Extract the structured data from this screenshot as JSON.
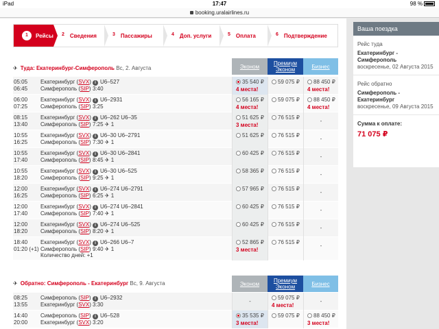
{
  "status": {
    "device": "iPad",
    "time": "17:47",
    "battery": "98 %"
  },
  "url": "booking.uralairlines.ru",
  "steps": [
    {
      "num": "1",
      "label": "Рейсы"
    },
    {
      "num": "2",
      "label": "Сведения"
    },
    {
      "num": "3",
      "label": "Пассажиры"
    },
    {
      "num": "4",
      "label": "Доп. услуги"
    },
    {
      "num": "5",
      "label": "Оплата"
    },
    {
      "num": "6",
      "label": "Подтверждение"
    }
  ],
  "fares": {
    "economy": "Эконом",
    "premium": "Премиум Эконом",
    "business": "Бизнес"
  },
  "outbound": {
    "title": "Туда: Екатеринбург-Симферополь",
    "date": "Вс, 2. Августа",
    "rows": [
      {
        "t1": "05:05",
        "t2": "06:45",
        "c1": "Екатеринбург",
        "k1": "SVX",
        "c2": "Симферополь",
        "k2": "SIP",
        "fl": "U6–527",
        "dur": "3:40",
        "eco": "35 540 ₽",
        "eco_seats": "4 места!",
        "eco_sel": true,
        "prem": "59 075 ₽",
        "prem_seats": "",
        "bus": "88 450 ₽",
        "bus_seats": "4 места!"
      },
      {
        "t1": "06:00",
        "t2": "07:25",
        "c1": "Екатеринбург",
        "k1": "SVX",
        "c2": "Симферополь",
        "k2": "SIP",
        "fl": "U6–2931",
        "dur": "3:25",
        "eco": "56 165 ₽",
        "eco_seats": "4 места!",
        "prem": "59 075 ₽",
        "prem_seats": "",
        "bus": "88 450 ₽",
        "bus_seats": "4 места!"
      },
      {
        "t1": "08:15",
        "t2": "13:40",
        "c1": "Екатеринбург",
        "k1": "SVX",
        "c2": "Симферополь",
        "k2": "SIP",
        "fl": "U6–262  U6–35",
        "dur": "7:25 ✈ 1",
        "eco": "51 625 ₽",
        "eco_seats": "3 места!",
        "prem": "76 515 ₽",
        "prem_seats": "",
        "bus": "-",
        "bus_seats": ""
      },
      {
        "t1": "10:55",
        "t2": "16:25",
        "c1": "Екатеринбург",
        "k1": "SVX",
        "c2": "Симферополь",
        "k2": "SIP",
        "fl": "U6–30  U6–2791",
        "dur": "7:30 ✈ 1",
        "eco": "51 625 ₽",
        "eco_seats": "",
        "prem": "76 515 ₽",
        "prem_seats": "",
        "bus": "-",
        "bus_seats": ""
      },
      {
        "t1": "10:55",
        "t2": "17:40",
        "c1": "Екатеринбург",
        "k1": "SVX",
        "c2": "Симферополь",
        "k2": "SIP",
        "fl": "U6–30  U6–2841",
        "dur": "8:45 ✈ 1",
        "eco": "60 425 ₽",
        "eco_seats": "",
        "prem": "76 515 ₽",
        "prem_seats": "",
        "bus": "-",
        "bus_seats": ""
      },
      {
        "t1": "10:55",
        "t2": "18:20",
        "c1": "Екатеринбург",
        "k1": "SVX",
        "c2": "Симферополь",
        "k2": "SIP",
        "fl": "U6–30  U6–525",
        "dur": "9:25 ✈ 1",
        "eco": "58 365 ₽",
        "eco_seats": "",
        "prem": "76 515 ₽",
        "prem_seats": "",
        "bus": "-",
        "bus_seats": ""
      },
      {
        "t1": "12:00",
        "t2": "16:25",
        "c1": "Екатеринбург",
        "k1": "SVX",
        "c2": "Симферополь",
        "k2": "SIP",
        "fl": "U6–274  U6–2791",
        "dur": "6:25 ✈ 1",
        "eco": "57 965 ₽",
        "eco_seats": "",
        "prem": "76 515 ₽",
        "prem_seats": "",
        "bus": "-",
        "bus_seats": ""
      },
      {
        "t1": "12:00",
        "t2": "17:40",
        "c1": "Екатеринбург",
        "k1": "SVX",
        "c2": "Симферополь",
        "k2": "SIP",
        "fl": "U6–274  U6–2841",
        "dur": "7:40 ✈ 1",
        "eco": "60 425 ₽",
        "eco_seats": "",
        "prem": "76 515 ₽",
        "prem_seats": "",
        "bus": "-",
        "bus_seats": ""
      },
      {
        "t1": "12:00",
        "t2": "18:20",
        "c1": "Екатеринбург",
        "k1": "SVX",
        "c2": "Симферополь",
        "k2": "SIP",
        "fl": "U6–274  U6–525",
        "dur": "8:20 ✈ 1",
        "eco": "60 425 ₽",
        "eco_seats": "",
        "prem": "76 515 ₽",
        "prem_seats": "",
        "bus": "-",
        "bus_seats": ""
      },
      {
        "t1": "18:40",
        "t2": "01:20 (+1)",
        "c1": "Екатеринбург",
        "k1": "SVX",
        "c2": "Симферополь",
        "k2": "SIP",
        "fl": "U6–266  U6–7",
        "dur": "9:40 ✈ 1",
        "eco": "52 865 ₽",
        "eco_seats": "3 места!",
        "prem": "76 515 ₽",
        "prem_seats": "",
        "bus": "-",
        "bus_seats": "",
        "days": "Количество дней: +1"
      }
    ]
  },
  "inbound": {
    "title": "Обратно: Симферополь - Екатеринбург",
    "date": "Вс, 9. Августа",
    "rows": [
      {
        "t1": "08:25",
        "t2": "13:55",
        "c1": "Симферополь",
        "k1": "SIP",
        "c2": "Екатеринбург",
        "k2": "SVX",
        "fl": "U6–2932",
        "dur": "3:30",
        "eco": "-",
        "eco_seats": "",
        "prem": "59 075 ₽",
        "prem_seats": "4 места!",
        "bus": "-",
        "bus_seats": ""
      },
      {
        "t1": "14:40",
        "t2": "20:00",
        "c1": "Симферополь",
        "k1": "SIP",
        "c2": "Екатеринбург",
        "k2": "SVX",
        "fl": "U6–528",
        "dur": "3:20",
        "eco": "35 535 ₽",
        "eco_seats": "3 места!",
        "eco_sel": true,
        "prem": "59 075 ₽",
        "prem_seats": "",
        "bus": "88 450 ₽",
        "bus_seats": "3 места!"
      }
    ]
  },
  "sidebar": {
    "title": "Ваша поездка",
    "out_label": "Рейс туда",
    "out_route": "Екатеринбург - Симферополь",
    "out_date": "воскресенье, 02 Августа 2015",
    "ret_label": "Рейс обратно",
    "ret_route": "Симферополь - Екатеринбург",
    "ret_date": "воскресенье, 09 Августа 2015",
    "total_label": "Сумма к оплате:",
    "total": "71 075 ₽"
  }
}
